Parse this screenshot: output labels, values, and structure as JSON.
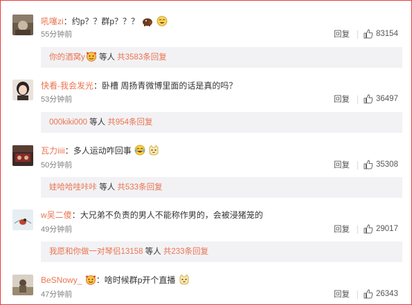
{
  "comments": [
    {
      "user": "吼噻zi",
      "colon": "：",
      "text": "约p？？群p？？？",
      "time": "55分钟前",
      "reply_label": "回复",
      "likes": "83154",
      "emojis": [
        "pig-icon",
        "laughing-cat-icon"
      ],
      "sub": {
        "user": "你的酒窝y",
        "user_emojis": [
          "smiling-face-icon"
        ],
        "mid": " 等人 ",
        "count": "共3583条回复"
      }
    },
    {
      "user": "快看-我会发光",
      "colon": "：",
      "text": "卧槽 周扬青微博里面的话是真的吗？",
      "time": "53分钟前",
      "reply_label": "回复",
      "likes": "36497",
      "emojis": [],
      "sub": {
        "user": "000kiki000",
        "user_emojis": [],
        "mid": " 等人 ",
        "count": "共954条回复"
      }
    },
    {
      "user": "瓦力iiii",
      "colon": "：",
      "text": "多人运动咋回事",
      "time": "50分钟前",
      "reply_label": "回复",
      "likes": "35308",
      "emojis": [
        "laughing-face-icon",
        "cat-face-icon"
      ],
      "sub": {
        "user": "娃哈哈哇咔咔",
        "user_emojis": [],
        "mid": " 等人 ",
        "count": "共533条回复"
      }
    },
    {
      "user": "w吴二傻",
      "colon": "：",
      "text": "大兄弟不负责的男人不能称作男的，会被浸猪笼的",
      "time": "49分钟前",
      "reply_label": "回复",
      "likes": "29017",
      "emojis": [],
      "sub": {
        "user": "我愿和你做一对琴侣13158",
        "user_emojis": [],
        "mid": " 等人 ",
        "count": "共233条回复"
      }
    },
    {
      "user": "BeSNowy_",
      "colon": "：",
      "text": "啥时候群p开个直播",
      "time": "47分钟前",
      "reply_label": "回复",
      "likes": "26343",
      "emojis": [
        "cat-face-icon"
      ],
      "user_badge": "smiling-face-icon"
    }
  ],
  "colors": {
    "frame": "#e8383d",
    "username": "#eb7350",
    "subbox": "#f2f2f5"
  }
}
